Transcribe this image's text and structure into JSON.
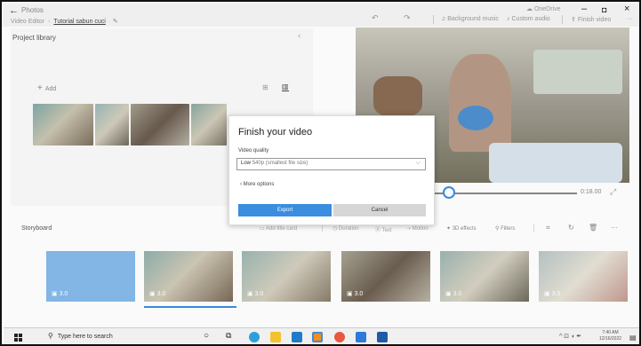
{
  "titlebar": {
    "back_icon": "back-arrow-icon",
    "app_name": "Photos",
    "breadcrumb_root": "Video Editor",
    "project_name": "Tutorial sabun cuci",
    "onedrive": "OneDrive",
    "minimize": "–",
    "maximize": "◘",
    "close": "×"
  },
  "toolbar": {
    "undo_icon": "undo-icon",
    "redo_icon": "redo-icon",
    "background_music": "Background music",
    "custom_audio": "Custom audio",
    "finish_video": "Finish video",
    "more": "···"
  },
  "library": {
    "title": "Project library",
    "add": "Add"
  },
  "preview": {
    "time": "0:18.00",
    "progress": 0.1
  },
  "storyboard": {
    "title": "Storyboard",
    "tools": [
      "Add title card",
      "Duration",
      "Text",
      "Motion",
      "3D effects",
      "Filters"
    ],
    "cards": [
      {
        "label": "3.0",
        "kind": "blue"
      },
      {
        "label": "3.0",
        "kind": "photo"
      },
      {
        "label": "3.0",
        "kind": "photo"
      },
      {
        "label": "3.0",
        "kind": "photo"
      },
      {
        "label": "3.0",
        "kind": "photo"
      },
      {
        "label": "3.0",
        "kind": "photo"
      }
    ]
  },
  "dialog": {
    "title": "Finish your video",
    "quality_label": "Video quality",
    "quality_value": "Low",
    "quality_sub": "540p (smallest file size)",
    "more_options": "More options",
    "export": "Export",
    "cancel": "Cancel"
  },
  "taskbar": {
    "search_placeholder": "Type here to search",
    "time": "7:40 AM",
    "date": "12/16/2022"
  },
  "colors": {
    "accent": "#3a8ddf",
    "card_blue": "#86b9ea"
  }
}
